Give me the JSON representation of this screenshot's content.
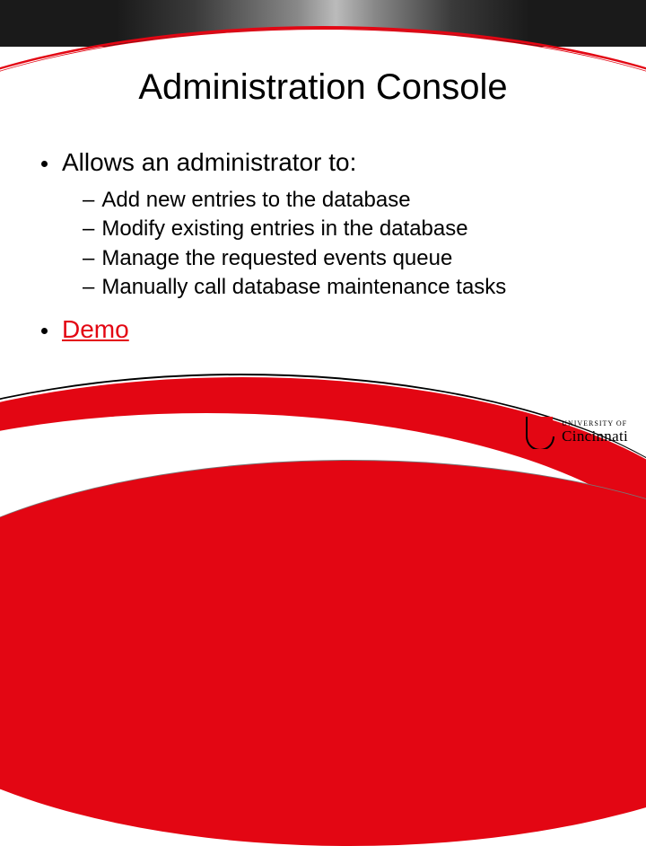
{
  "title": "Administration Console",
  "intro": "Allows an administrator to:",
  "items": [
    "Add new entries to the database",
    "Modify existing entries in the database",
    "Manage the requested events queue",
    "Manually call database maintenance tasks"
  ],
  "demo": "Demo",
  "logo": {
    "small": "UNIVERSITY OF",
    "big": "Cincinnati"
  },
  "colors": {
    "accent": "#e30613"
  }
}
